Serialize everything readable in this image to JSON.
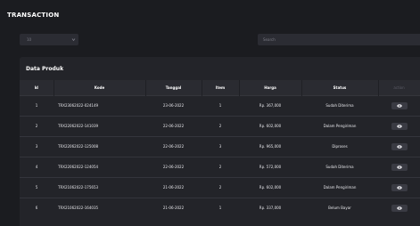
{
  "header": {
    "title": "TRANSACTION"
  },
  "filter": {
    "value": "10"
  },
  "search": {
    "placeholder": "Search"
  },
  "card": {
    "title": "Data Produk"
  },
  "table": {
    "columns": [
      "Id",
      "Kode",
      "Tanggal",
      "Item",
      "Harga",
      "Status",
      "action"
    ],
    "rows": [
      {
        "id": "1",
        "kode": "TRX23062022-024149",
        "tanggal": "23-06-2022",
        "item": "1",
        "harga": "Rp. 367,000",
        "status": "Sudah Diterima"
      },
      {
        "id": "2",
        "kode": "TRX22062022-141039",
        "tanggal": "22-06-2022",
        "item": "2",
        "harga": "Rp. 602,000",
        "status": "Dalam Pengiriman"
      },
      {
        "id": "3",
        "kode": "TRX22062022-125008",
        "tanggal": "22-06-2022",
        "item": "3",
        "harga": "Rp. 965,000",
        "status": "Diproses"
      },
      {
        "id": "4",
        "kode": "TRX22062022-124054",
        "tanggal": "22-06-2022",
        "item": "2",
        "harga": "Rp. 572,000",
        "status": "Sudah Diterima"
      },
      {
        "id": "5",
        "kode": "TRX21062022-175653",
        "tanggal": "21-06-2022",
        "item": "2",
        "harga": "Rp. 602,000",
        "status": "Dalam Pengiriman"
      },
      {
        "id": "6",
        "kode": "TRX21062022-164035",
        "tanggal": "21-06-2022",
        "item": "1",
        "harga": "Rp. 337,000",
        "status": "Belum Bayar"
      }
    ]
  },
  "icons": {
    "view": "eye-icon",
    "dropdown": "chevron-down-icon"
  },
  "colors": {
    "background": "#1b1c20",
    "card": "#232429",
    "header_row": "#2a2b31",
    "button": "#3a3b43"
  }
}
